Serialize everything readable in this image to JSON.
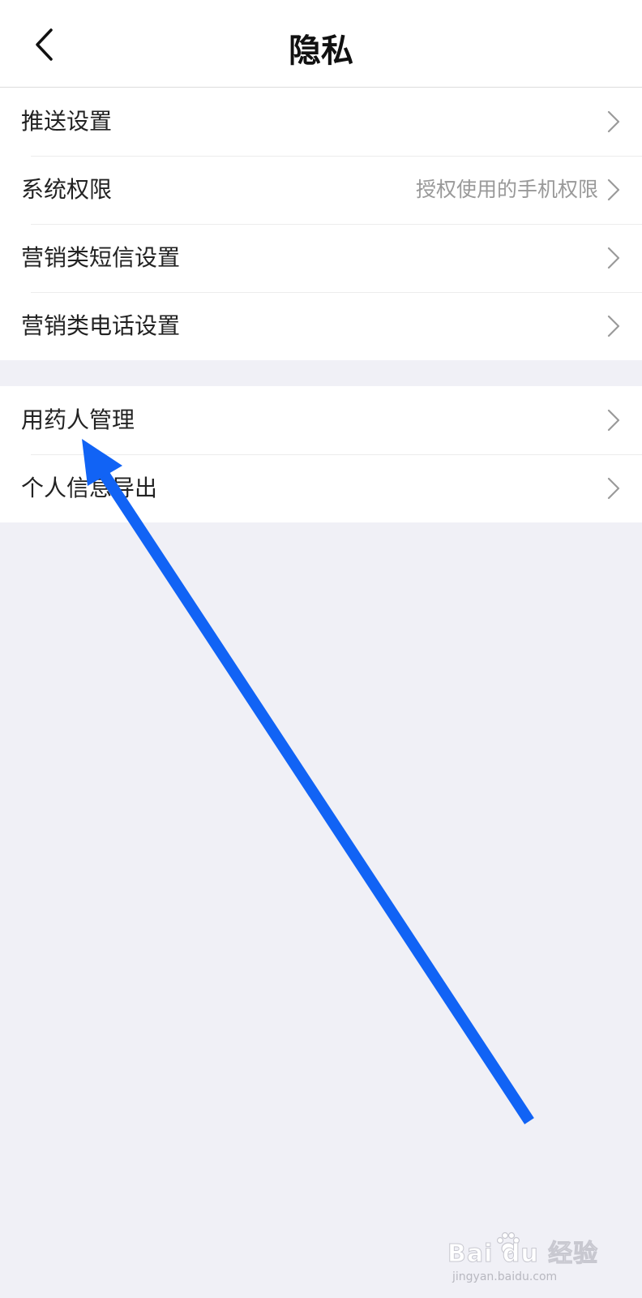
{
  "header": {
    "title": "隐私",
    "back_icon": "chevron-left-icon"
  },
  "groups": [
    {
      "items": [
        {
          "label": "推送设置",
          "value": ""
        },
        {
          "label": "系统权限",
          "value": "授权使用的手机权限"
        },
        {
          "label": "营销类短信设置",
          "value": ""
        },
        {
          "label": "营销类电话设置",
          "value": ""
        }
      ]
    },
    {
      "items": [
        {
          "label": "用药人管理",
          "value": ""
        },
        {
          "label": "个人信息导出",
          "value": ""
        }
      ]
    }
  ],
  "annotation": {
    "type": "arrow",
    "color": "#1163f5",
    "points_to": "用药人管理"
  },
  "watermark": {
    "brand": "Bai du 经验",
    "url": "jingyan.baidu.com"
  },
  "colors": {
    "background": "#f0f0f6",
    "surface": "#ffffff",
    "text_primary": "#222222",
    "text_secondary": "#999999"
  }
}
